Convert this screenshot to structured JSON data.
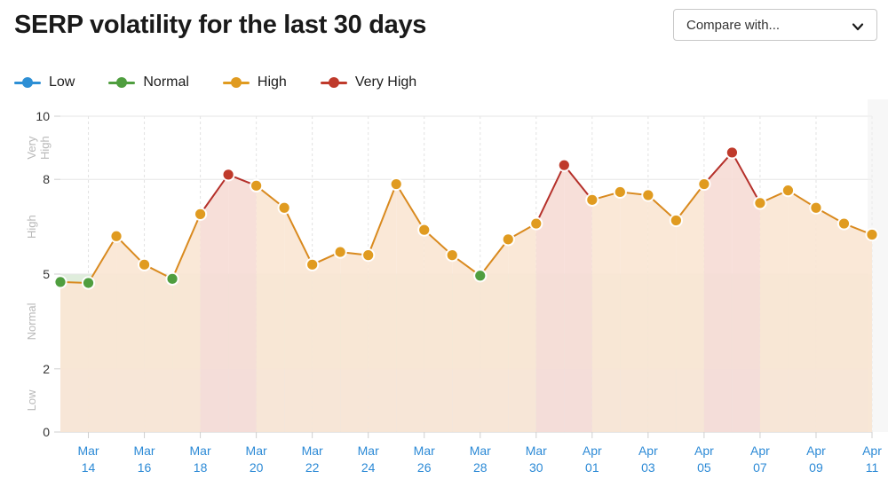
{
  "header": {
    "title": "SERP volatility for the last 30 days",
    "compare": {
      "label": "Compare with...",
      "icon": "chevron-down-icon"
    }
  },
  "legend": {
    "items": [
      {
        "label": "Low",
        "color": "#2d8fd5"
      },
      {
        "label": "Normal",
        "color": "#4f9e3f"
      },
      {
        "label": "High",
        "color": "#e09b20"
      },
      {
        "label": "Very High",
        "color": "#bf3a2b"
      }
    ]
  },
  "colors": {
    "low": "#2d8fd5",
    "normal": "#4f9e3f",
    "high": "#e09b20",
    "very_high": "#bf3a2b",
    "band_low": "#d9e7f4",
    "band_normal": "#dfeddc",
    "band_high": "#ffffff",
    "band_very_high": "#ffffff",
    "area_high": "#fae6d4",
    "area_very_high": "#f6dcd6",
    "line_high": "#d98a1f",
    "line_very_high": "#b5302a",
    "axis_text": "#333333",
    "xtick_text": "#2c8ad6",
    "grid": "#ebebeb",
    "band_label": "#b9b9b9",
    "future_shade": "#f0f0f0"
  },
  "chart_data": {
    "type": "line",
    "title": "SERP volatility for the last 30 days",
    "xlabel": "",
    "ylabel": "",
    "ylim": [
      0,
      10
    ],
    "yticks": [
      0,
      2,
      5,
      8,
      10
    ],
    "grid": true,
    "legend_position": "top-left",
    "bands": [
      {
        "name": "Low",
        "from": 0,
        "to": 2,
        "fill": "#d9e7f4"
      },
      {
        "name": "Normal",
        "from": 2,
        "to": 5,
        "fill": "#dfeddc"
      },
      {
        "name": "High",
        "from": 5,
        "to": 8,
        "fill": "#ffffff"
      },
      {
        "name": "Very High",
        "from": 8,
        "to": 10,
        "fill": "#ffffff"
      }
    ],
    "xtick_labels": [
      "Mar\n14",
      "Mar\n16",
      "Mar\n18",
      "Mar\n20",
      "Mar\n22",
      "Mar\n24",
      "Mar\n26",
      "Mar\n28",
      "Mar\n30",
      "Apr\n01",
      "Apr\n03",
      "Apr\n05",
      "Apr\n07",
      "Apr\n09",
      "Apr\n11"
    ],
    "xtick_indices": [
      1,
      3,
      5,
      7,
      9,
      11,
      13,
      15,
      17,
      19,
      21,
      23,
      25,
      27,
      29
    ],
    "x": [
      "Mar 13",
      "Mar 14",
      "Mar 15",
      "Mar 16",
      "Mar 17",
      "Mar 18",
      "Mar 19",
      "Mar 20",
      "Mar 21",
      "Mar 22",
      "Mar 23",
      "Mar 24",
      "Mar 25",
      "Mar 26",
      "Mar 27",
      "Mar 28",
      "Mar 29",
      "Mar 30",
      "Mar 31",
      "Apr 01",
      "Apr 02",
      "Apr 03",
      "Apr 04",
      "Apr 05",
      "Apr 06",
      "Apr 07",
      "Apr 08",
      "Apr 09",
      "Apr 10",
      "Apr 11"
    ],
    "values": [
      4.75,
      4.72,
      6.2,
      5.3,
      4.85,
      6.9,
      8.15,
      7.8,
      7.1,
      5.3,
      5.7,
      5.6,
      7.85,
      6.4,
      5.6,
      4.95,
      6.1,
      6.6,
      8.45,
      7.35,
      7.6,
      7.5,
      6.7,
      7.85,
      8.85,
      7.25,
      7.65,
      7.1,
      6.6,
      6.25
    ],
    "point_levels": [
      "normal",
      "normal",
      "high",
      "high",
      "normal",
      "high",
      "very_high",
      "high",
      "high",
      "high",
      "high",
      "high",
      "high",
      "high",
      "high",
      "normal",
      "high",
      "high",
      "very_high",
      "high",
      "high",
      "high",
      "high",
      "high",
      "very_high",
      "high",
      "high",
      "high",
      "high",
      "high"
    ],
    "thresholds": {
      "low_max": 2,
      "normal_max": 5,
      "high_max": 8
    },
    "future_region": {
      "from_index": 29,
      "shaded": true
    }
  }
}
